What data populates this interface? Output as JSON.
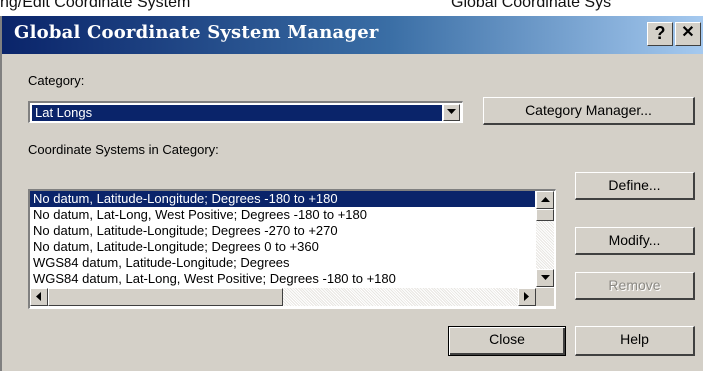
{
  "background_title_strip": {
    "left": "ng/Edit Coordinate System",
    "right": "Global Coordinate Sys"
  },
  "dialog": {
    "title": "Global Coordinate System Manager",
    "help_button": "?",
    "close_button": "✕",
    "category_label": "Category:",
    "category_value": "Lat Longs",
    "category_manager_button": "Category Manager...",
    "systems_label": "Coordinate Systems in Category:",
    "systems": [
      "No datum, Latitude-Longitude; Degrees -180 to +180",
      "No datum, Lat-Long, West Positive; Degrees -180 to +180",
      "No datum, Latitude-Longitude; Degrees -270 to +270",
      "No datum, Latitude-Longitude; Degrees 0 to +360",
      "WGS84 datum, Latitude-Longitude; Degrees",
      "WGS84 datum, Lat-Long, West Positive; Degrees -180 to +180"
    ],
    "selected_index": 0,
    "define_button": "Define...",
    "modify_button": "Modify...",
    "remove_button": "Remove",
    "close_dialog_button": "Close",
    "help_dialog_button": "Help"
  },
  "icons": {
    "dropdown": "chevron-down-icon",
    "scroll_up": "arrow-up-icon",
    "scroll_down": "arrow-down-icon",
    "scroll_left": "arrow-left-icon",
    "scroll_right": "arrow-right-icon"
  },
  "colors": {
    "selection": "#0a246a",
    "dialog_face": "#d4d0c8"
  }
}
